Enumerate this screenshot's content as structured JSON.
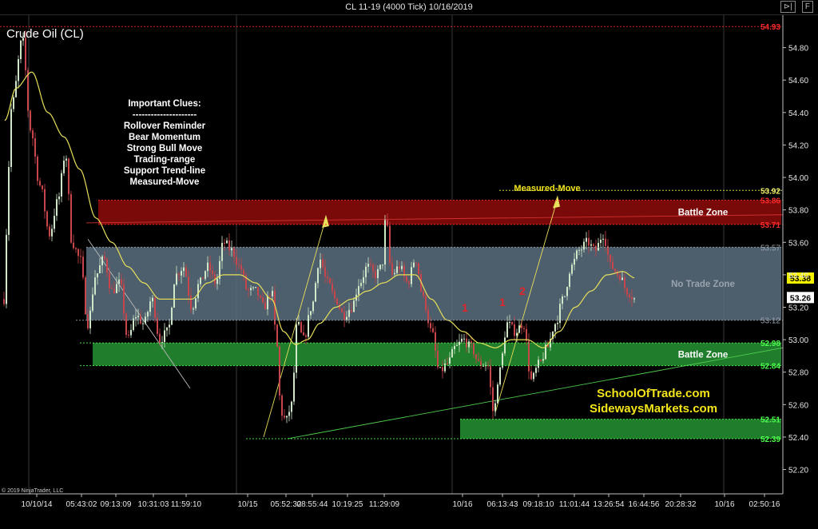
{
  "window": {
    "title": "CL 11-19 (4000 Tick)  10/16/2019",
    "icons": [
      "pin-icon",
      "flag-icon"
    ]
  },
  "chart_data": {
    "type": "candlestick",
    "title": "Crude Oil (CL)",
    "copyright": "© 2019 NinjaTrader, LLC",
    "ylim": [
      52.05,
      55.0
    ],
    "y_ticks": [
      "54.80",
      "54.60",
      "54.40",
      "54.20",
      "54.00",
      "53.80",
      "53.60",
      "53.40",
      "53.20",
      "53.00",
      "52.80",
      "52.60",
      "52.40",
      "52.20"
    ],
    "x_ticks": [
      "10/10/14",
      "05:43:02",
      "09:13:09",
      "10:31:03",
      "11:59:10",
      "10/15",
      "05:52:32",
      "08:55:44",
      "10:19:25",
      "11:29:09",
      "10/16",
      "06:13:43",
      "09:18:10",
      "11:01:44",
      "13:26:54",
      "16:44:56",
      "20:28:32",
      "10/16",
      "02:50:16"
    ],
    "x_tick_positions": [
      46,
      102,
      145,
      192,
      233,
      310,
      358,
      391,
      435,
      481,
      579,
      629,
      674,
      719,
      762,
      806,
      852,
      907,
      957
    ],
    "close_path_knots": [
      [
        6,
        53.55
      ],
      [
        15,
        54.45
      ],
      [
        28,
        54.85
      ],
      [
        38,
        54.3
      ],
      [
        50,
        53.95
      ],
      [
        62,
        53.65
      ],
      [
        72,
        53.85
      ],
      [
        82,
        54.15
      ],
      [
        90,
        53.6
      ],
      [
        100,
        53.5
      ],
      [
        110,
        53.1
      ],
      [
        120,
        53.4
      ],
      [
        130,
        53.5
      ],
      [
        140,
        53.3
      ],
      [
        150,
        53.35
      ],
      [
        160,
        53.0
      ],
      [
        170,
        53.15
      ],
      [
        180,
        53.1
      ],
      [
        190,
        53.25
      ],
      [
        200,
        53.0
      ],
      [
        210,
        53.05
      ],
      [
        220,
        53.4
      ],
      [
        230,
        53.45
      ],
      [
        240,
        53.2
      ],
      [
        250,
        53.35
      ],
      [
        260,
        53.45
      ],
      [
        270,
        53.35
      ],
      [
        280,
        53.6
      ],
      [
        290,
        53.55
      ],
      [
        300,
        53.45
      ],
      [
        310,
        53.3
      ],
      [
        320,
        53.3
      ],
      [
        330,
        53.2
      ],
      [
        340,
        53.3
      ],
      [
        345,
        53.05
      ],
      [
        352,
        52.55
      ],
      [
        358,
        52.5
      ],
      [
        365,
        52.6
      ],
      [
        372,
        53.1
      ],
      [
        380,
        53.0
      ],
      [
        390,
        53.2
      ],
      [
        400,
        53.5
      ],
      [
        410,
        53.35
      ],
      [
        420,
        53.25
      ],
      [
        430,
        53.15
      ],
      [
        440,
        53.2
      ],
      [
        450,
        53.35
      ],
      [
        460,
        53.45
      ],
      [
        470,
        53.4
      ],
      [
        478,
        53.45
      ],
      [
        483,
        53.75
      ],
      [
        490,
        53.4
      ],
      [
        500,
        53.45
      ],
      [
        510,
        53.35
      ],
      [
        520,
        53.5
      ],
      [
        530,
        53.25
      ],
      [
        540,
        53.05
      ],
      [
        550,
        52.8
      ],
      [
        560,
        52.85
      ],
      [
        570,
        52.95
      ],
      [
        580,
        53.0
      ],
      [
        590,
        52.95
      ],
      [
        600,
        52.85
      ],
      [
        610,
        52.85
      ],
      [
        618,
        52.55
      ],
      [
        625,
        52.8
      ],
      [
        635,
        53.1
      ],
      [
        645,
        53.05
      ],
      [
        655,
        53.1
      ],
      [
        665,
        52.75
      ],
      [
        675,
        52.85
      ],
      [
        685,
        52.95
      ],
      [
        695,
        53.1
      ],
      [
        705,
        53.25
      ],
      [
        715,
        53.45
      ],
      [
        725,
        53.55
      ],
      [
        735,
        53.6
      ],
      [
        745,
        53.55
      ],
      [
        755,
        53.65
      ],
      [
        765,
        53.45
      ],
      [
        775,
        53.4
      ],
      [
        785,
        53.3
      ],
      [
        795,
        53.25
      ]
    ],
    "moving_average_knots": [
      [
        6,
        54.35
      ],
      [
        20,
        54.55
      ],
      [
        40,
        54.65
      ],
      [
        60,
        54.4
      ],
      [
        80,
        54.25
      ],
      [
        100,
        54.05
      ],
      [
        120,
        53.75
      ],
      [
        140,
        53.6
      ],
      [
        160,
        53.45
      ],
      [
        180,
        53.35
      ],
      [
        200,
        53.25
      ],
      [
        220,
        53.25
      ],
      [
        240,
        53.25
      ],
      [
        260,
        53.35
      ],
      [
        280,
        53.4
      ],
      [
        300,
        53.4
      ],
      [
        320,
        53.35
      ],
      [
        340,
        53.25
      ],
      [
        355,
        53.05
      ],
      [
        370,
        52.97
      ],
      [
        385,
        53.0
      ],
      [
        400,
        53.1
      ],
      [
        420,
        53.2
      ],
      [
        440,
        53.25
      ],
      [
        460,
        53.3
      ],
      [
        480,
        53.35
      ],
      [
        500,
        53.4
      ],
      [
        520,
        53.4
      ],
      [
        540,
        53.25
      ],
      [
        560,
        53.12
      ],
      [
        580,
        53.05
      ],
      [
        600,
        52.98
      ],
      [
        620,
        52.95
      ],
      [
        640,
        53.0
      ],
      [
        660,
        53.0
      ],
      [
        680,
        52.95
      ],
      [
        700,
        53.05
      ],
      [
        720,
        53.2
      ],
      [
        740,
        53.3
      ],
      [
        760,
        53.4
      ],
      [
        780,
        53.42
      ],
      [
        795,
        53.38
      ]
    ],
    "price_levels": [
      {
        "label": "54.93",
        "value": 54.93,
        "color": "#ff2a2a"
      },
      {
        "label": "53.92",
        "value": 53.92,
        "color": "#f3f36b"
      },
      {
        "label": "53.86",
        "value": 53.86,
        "color": "#ff2a2a"
      },
      {
        "label": "53.71",
        "value": 53.71,
        "color": "#ff2a2a"
      },
      {
        "label": "53.57",
        "value": 53.57,
        "color": "#9aa3ad"
      },
      {
        "label": "53.12",
        "value": 53.12,
        "color": "#9aa3ad"
      },
      {
        "label": "52.98",
        "value": 52.98,
        "color": "#4dff4d"
      },
      {
        "label": "52.84",
        "value": 52.84,
        "color": "#4dff4d"
      },
      {
        "label": "52.51",
        "value": 52.51,
        "color": "#4dff4d"
      },
      {
        "label": "52.39",
        "value": 52.39,
        "color": "#4dff4d"
      }
    ],
    "current_price_markers": [
      {
        "label": "53.38",
        "value": 53.38,
        "bg": "#f4f100",
        "fg": "#000000"
      },
      {
        "label": "53.26",
        "value": 53.26,
        "bg": "#ffffff",
        "fg": "#000000"
      }
    ],
    "zones": [
      {
        "label": "Battle Zone",
        "top": 53.86,
        "bottom": 53.71,
        "color": "#7a0a0a"
      },
      {
        "label": "No Trade Zone",
        "top": 53.57,
        "bottom": 53.12,
        "color": "#5a6e7f"
      },
      {
        "label": "Battle Zone",
        "top": 52.98,
        "bottom": 52.84,
        "color": "#1f7d2c"
      },
      {
        "label": "",
        "top": 52.51,
        "bottom": 52.39,
        "color": "#1f7d2c"
      }
    ],
    "annotations": {
      "clues_title": "Important Clues:",
      "clues_divider": "---------------------",
      "clues": [
        "Rollover Reminder",
        "Bear Momentum",
        "Strong Bull Move",
        "Trading-range",
        "Support Trend-line",
        "Measured-Move"
      ],
      "measured_move": "Measured-Move",
      "swing_labels": [
        "1",
        "1",
        "2"
      ],
      "site_1": "SchoolOfTrade.com",
      "site_2": "SidewaysMarkets.com"
    },
    "colors": {
      "up_candle": "#cfe6c8",
      "down_candle": "#c7454b",
      "moving_average": "#e8e05a",
      "text_yellow": "#f3e51a",
      "swing_label": "#e3252b"
    }
  }
}
